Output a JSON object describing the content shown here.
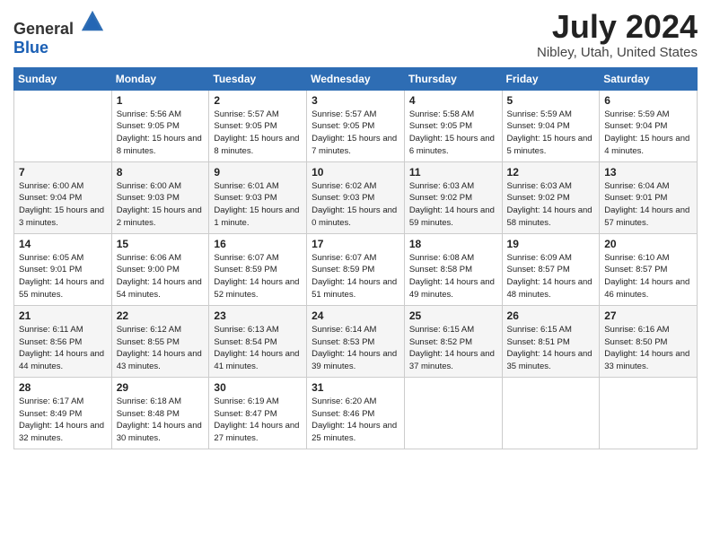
{
  "header": {
    "logo_general": "General",
    "logo_blue": "Blue",
    "month_year": "July 2024",
    "location": "Nibley, Utah, United States"
  },
  "days_of_week": [
    "Sunday",
    "Monday",
    "Tuesday",
    "Wednesday",
    "Thursday",
    "Friday",
    "Saturday"
  ],
  "weeks": [
    [
      {
        "day": "",
        "sunrise": "",
        "sunset": "",
        "daylight": ""
      },
      {
        "day": "1",
        "sunrise": "Sunrise: 5:56 AM",
        "sunset": "Sunset: 9:05 PM",
        "daylight": "Daylight: 15 hours and 8 minutes."
      },
      {
        "day": "2",
        "sunrise": "Sunrise: 5:57 AM",
        "sunset": "Sunset: 9:05 PM",
        "daylight": "Daylight: 15 hours and 8 minutes."
      },
      {
        "day": "3",
        "sunrise": "Sunrise: 5:57 AM",
        "sunset": "Sunset: 9:05 PM",
        "daylight": "Daylight: 15 hours and 7 minutes."
      },
      {
        "day": "4",
        "sunrise": "Sunrise: 5:58 AM",
        "sunset": "Sunset: 9:05 PM",
        "daylight": "Daylight: 15 hours and 6 minutes."
      },
      {
        "day": "5",
        "sunrise": "Sunrise: 5:59 AM",
        "sunset": "Sunset: 9:04 PM",
        "daylight": "Daylight: 15 hours and 5 minutes."
      },
      {
        "day": "6",
        "sunrise": "Sunrise: 5:59 AM",
        "sunset": "Sunset: 9:04 PM",
        "daylight": "Daylight: 15 hours and 4 minutes."
      }
    ],
    [
      {
        "day": "7",
        "sunrise": "Sunrise: 6:00 AM",
        "sunset": "Sunset: 9:04 PM",
        "daylight": "Daylight: 15 hours and 3 minutes."
      },
      {
        "day": "8",
        "sunrise": "Sunrise: 6:00 AM",
        "sunset": "Sunset: 9:03 PM",
        "daylight": "Daylight: 15 hours and 2 minutes."
      },
      {
        "day": "9",
        "sunrise": "Sunrise: 6:01 AM",
        "sunset": "Sunset: 9:03 PM",
        "daylight": "Daylight: 15 hours and 1 minute."
      },
      {
        "day": "10",
        "sunrise": "Sunrise: 6:02 AM",
        "sunset": "Sunset: 9:03 PM",
        "daylight": "Daylight: 15 hours and 0 minutes."
      },
      {
        "day": "11",
        "sunrise": "Sunrise: 6:03 AM",
        "sunset": "Sunset: 9:02 PM",
        "daylight": "Daylight: 14 hours and 59 minutes."
      },
      {
        "day": "12",
        "sunrise": "Sunrise: 6:03 AM",
        "sunset": "Sunset: 9:02 PM",
        "daylight": "Daylight: 14 hours and 58 minutes."
      },
      {
        "day": "13",
        "sunrise": "Sunrise: 6:04 AM",
        "sunset": "Sunset: 9:01 PM",
        "daylight": "Daylight: 14 hours and 57 minutes."
      }
    ],
    [
      {
        "day": "14",
        "sunrise": "Sunrise: 6:05 AM",
        "sunset": "Sunset: 9:01 PM",
        "daylight": "Daylight: 14 hours and 55 minutes."
      },
      {
        "day": "15",
        "sunrise": "Sunrise: 6:06 AM",
        "sunset": "Sunset: 9:00 PM",
        "daylight": "Daylight: 14 hours and 54 minutes."
      },
      {
        "day": "16",
        "sunrise": "Sunrise: 6:07 AM",
        "sunset": "Sunset: 8:59 PM",
        "daylight": "Daylight: 14 hours and 52 minutes."
      },
      {
        "day": "17",
        "sunrise": "Sunrise: 6:07 AM",
        "sunset": "Sunset: 8:59 PM",
        "daylight": "Daylight: 14 hours and 51 minutes."
      },
      {
        "day": "18",
        "sunrise": "Sunrise: 6:08 AM",
        "sunset": "Sunset: 8:58 PM",
        "daylight": "Daylight: 14 hours and 49 minutes."
      },
      {
        "day": "19",
        "sunrise": "Sunrise: 6:09 AM",
        "sunset": "Sunset: 8:57 PM",
        "daylight": "Daylight: 14 hours and 48 minutes."
      },
      {
        "day": "20",
        "sunrise": "Sunrise: 6:10 AM",
        "sunset": "Sunset: 8:57 PM",
        "daylight": "Daylight: 14 hours and 46 minutes."
      }
    ],
    [
      {
        "day": "21",
        "sunrise": "Sunrise: 6:11 AM",
        "sunset": "Sunset: 8:56 PM",
        "daylight": "Daylight: 14 hours and 44 minutes."
      },
      {
        "day": "22",
        "sunrise": "Sunrise: 6:12 AM",
        "sunset": "Sunset: 8:55 PM",
        "daylight": "Daylight: 14 hours and 43 minutes."
      },
      {
        "day": "23",
        "sunrise": "Sunrise: 6:13 AM",
        "sunset": "Sunset: 8:54 PM",
        "daylight": "Daylight: 14 hours and 41 minutes."
      },
      {
        "day": "24",
        "sunrise": "Sunrise: 6:14 AM",
        "sunset": "Sunset: 8:53 PM",
        "daylight": "Daylight: 14 hours and 39 minutes."
      },
      {
        "day": "25",
        "sunrise": "Sunrise: 6:15 AM",
        "sunset": "Sunset: 8:52 PM",
        "daylight": "Daylight: 14 hours and 37 minutes."
      },
      {
        "day": "26",
        "sunrise": "Sunrise: 6:15 AM",
        "sunset": "Sunset: 8:51 PM",
        "daylight": "Daylight: 14 hours and 35 minutes."
      },
      {
        "day": "27",
        "sunrise": "Sunrise: 6:16 AM",
        "sunset": "Sunset: 8:50 PM",
        "daylight": "Daylight: 14 hours and 33 minutes."
      }
    ],
    [
      {
        "day": "28",
        "sunrise": "Sunrise: 6:17 AM",
        "sunset": "Sunset: 8:49 PM",
        "daylight": "Daylight: 14 hours and 32 minutes."
      },
      {
        "day": "29",
        "sunrise": "Sunrise: 6:18 AM",
        "sunset": "Sunset: 8:48 PM",
        "daylight": "Daylight: 14 hours and 30 minutes."
      },
      {
        "day": "30",
        "sunrise": "Sunrise: 6:19 AM",
        "sunset": "Sunset: 8:47 PM",
        "daylight": "Daylight: 14 hours and 27 minutes."
      },
      {
        "day": "31",
        "sunrise": "Sunrise: 6:20 AM",
        "sunset": "Sunset: 8:46 PM",
        "daylight": "Daylight: 14 hours and 25 minutes."
      },
      {
        "day": "",
        "sunrise": "",
        "sunset": "",
        "daylight": ""
      },
      {
        "day": "",
        "sunrise": "",
        "sunset": "",
        "daylight": ""
      },
      {
        "day": "",
        "sunrise": "",
        "sunset": "",
        "daylight": ""
      }
    ]
  ]
}
